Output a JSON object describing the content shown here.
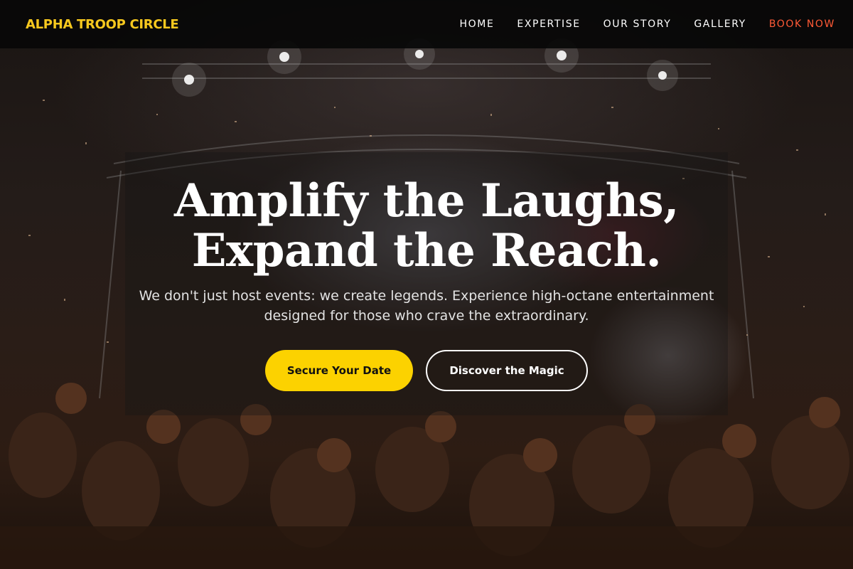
{
  "brand": {
    "name": "ALPHA TROOP CIRCLE",
    "color": "#f7c81e"
  },
  "nav": {
    "items": [
      {
        "label": "HOME"
      },
      {
        "label": "EXPERTISE"
      },
      {
        "label": "OUR STORY"
      },
      {
        "label": "GALLERY"
      },
      {
        "label": "BOOK NOW",
        "accent": "#ff5a36"
      }
    ]
  },
  "hero": {
    "headline_line1": "Amplify the Laughs,",
    "headline_line2": "Expand the Reach.",
    "subtitle_line1": "We don't just host events: we create legends. Experience high-octane entertainment",
    "subtitle_line2": "designed for those who crave the extraordinary.",
    "primary_button": "Secure Your Date",
    "secondary_button": "Discover the Magic",
    "primary_color": "#fcd200",
    "background_image": "concert-crowd-with-confetti"
  }
}
